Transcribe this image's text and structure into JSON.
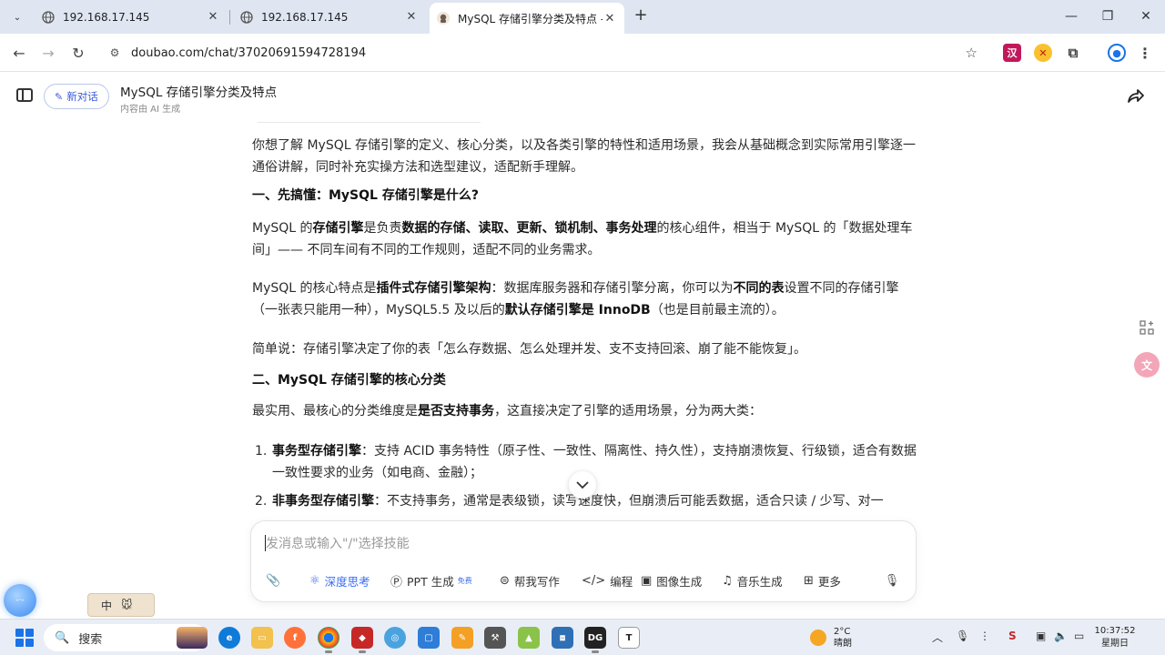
{
  "browser": {
    "tabs": [
      {
        "title": "192.168.17.145",
        "active": false
      },
      {
        "title": "192.168.17.145",
        "active": false
      },
      {
        "title": "MySQL 存储引擎分类及特点 -",
        "active": true
      }
    ],
    "url": "doubao.com/chat/37020691594728194"
  },
  "header": {
    "new_chat_label": "新对话",
    "title": "MySQL 存储引擎分类及特点",
    "subtitle": "内容由 AI 生成"
  },
  "content": {
    "intro": "你想了解 MySQL 存储引擎的定义、核心分类，以及各类引擎的特性和适用场景，我会从基础概念到实际常用引擎逐一通俗讲解，同时补充实操方法和选型建议，适配新手理解。",
    "h1": "一、先搞懂：MySQL 存储引擎是什么?",
    "p1": {
      "a": "MySQL 的",
      "b": "存储引擎",
      "c": "是负责",
      "d": "数据的存储、读取、更新、锁机制、事务处理",
      "e": "的核心组件，相当于 MySQL 的「数据处理车间」—— 不同车间有不同的工作规则，适配不同的业务需求。"
    },
    "p2": {
      "a": "MySQL 的核心特点是",
      "b": "插件式存储引擎架构",
      "c": "：数据库服务器和存储引擎分离，你可以为",
      "d": "不同的表",
      "e": "设置不同的存储引擎（一张表只能用一种），MySQL5.5 及以后的",
      "f": "默认存储引擎是 InnoDB",
      "g": "（也是目前最主流的）。"
    },
    "p3": "简单说：存储引擎决定了你的表「怎么存数据、怎么处理并发、支不支持回滚、崩了能不能恢复」。",
    "h2": "二、MySQL 存储引擎的核心分类",
    "p4": {
      "a": "最实用、最核心的分类维度是",
      "b": "是否支持事务",
      "c": "，这直接决定了引擎的适用场景，分为两大类："
    },
    "list": [
      {
        "num": "1.",
        "bold": "事务型存储引擎",
        "text": "：支持 ACID 事务特性（原子性、一致性、隔离性、持久性），支持崩溃恢复、行级锁，适合有数据一致性要求的业务（如电商、金融）；"
      },
      {
        "num": "2.",
        "bold": "非事务型存储引擎",
        "text": "：不支持事务，通常是表级锁，读写速度快，但崩溃后可能丢数据，适合只读 / 少写、对一"
      }
    ]
  },
  "input": {
    "placeholder": "发消息或输入\"/\"选择技能",
    "tools": [
      {
        "label": "深度思考",
        "icon": "deep-think-icon"
      },
      {
        "label": "PPT 生成",
        "icon": "ppt-icon",
        "badge": "免费"
      },
      {
        "label": "帮我写作",
        "icon": "write-icon"
      },
      {
        "label": "编程",
        "icon": "code-icon"
      },
      {
        "label": "图像生成",
        "icon": "image-icon"
      },
      {
        "label": "音乐生成",
        "icon": "music-icon"
      },
      {
        "label": "更多",
        "icon": "grid-icon"
      }
    ]
  },
  "ime": {
    "mode": "中"
  },
  "taskbar": {
    "search_label": "搜索",
    "weather_temp": "2°C",
    "weather_desc": "晴朗",
    "time": "10:37:52",
    "day": "星期日"
  },
  "colors": {
    "accent": "#3b6cf5",
    "tabstrip": "#dfe6f1",
    "taskbar": "#e9eef6"
  }
}
